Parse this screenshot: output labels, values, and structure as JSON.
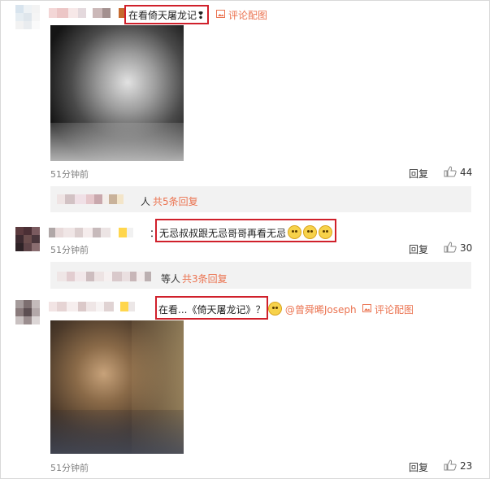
{
  "comments": [
    {
      "text": "在看倚天屠龙记❢",
      "pic_label": "评论配图",
      "time": "51分钟前",
      "reply_label": "回复",
      "likes": "44"
    },
    {
      "sub_replies_suffix": "人",
      "sub_replies_link": "共5条回复"
    },
    {
      "text": "：无忌叔叔跟无忌哥哥再看无忌",
      "time": "51分钟前",
      "reply_label": "回复",
      "likes": "30"
    },
    {
      "sub_replies_suffix": "等人",
      "sub_replies_link": "共3条回复"
    },
    {
      "text": "在看...《倚天屠龙记》？",
      "mention": "@曾舜晞Joseph",
      "pic_label": "评论配图",
      "time": "51分钟前",
      "reply_label": "回复",
      "likes": "23"
    }
  ],
  "colors": {
    "highlight_box": "#d0202b",
    "link": "#eb7350",
    "meta": "#808080",
    "sub_bar": "#f2f2f2"
  },
  "icons": [
    "picture-icon",
    "thumbs-up-icon",
    "emoji-icon"
  ]
}
